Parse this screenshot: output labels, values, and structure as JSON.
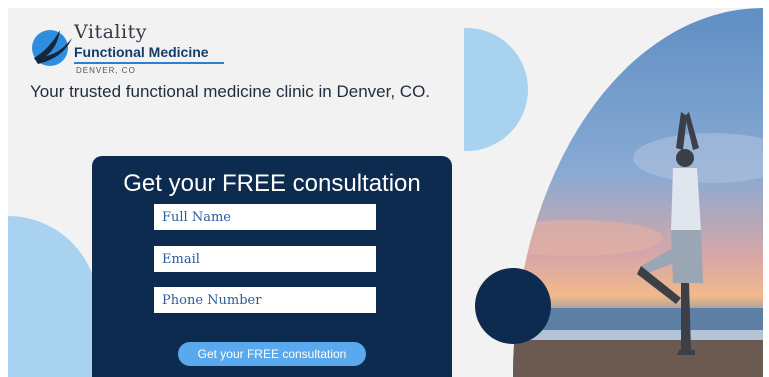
{
  "logo": {
    "script_text": "Vitality",
    "main_text": "Functional Medicine",
    "city_text": "DENVER, CO",
    "icon": "bird-icon"
  },
  "tagline": "Your trusted functional medicine clinic in Denver, CO.",
  "form": {
    "title": "Get your FREE consultation",
    "fields": {
      "full_name_placeholder": "Full Name",
      "email_placeholder": "Email",
      "phone_placeholder": "Phone Number"
    },
    "submit_label": "Get your FREE consultation"
  },
  "colors": {
    "navy": "#0d2b4e",
    "light_blue": "#a8d2f0",
    "button_blue": "#5aa9ec",
    "background": "#f2f2f2"
  }
}
